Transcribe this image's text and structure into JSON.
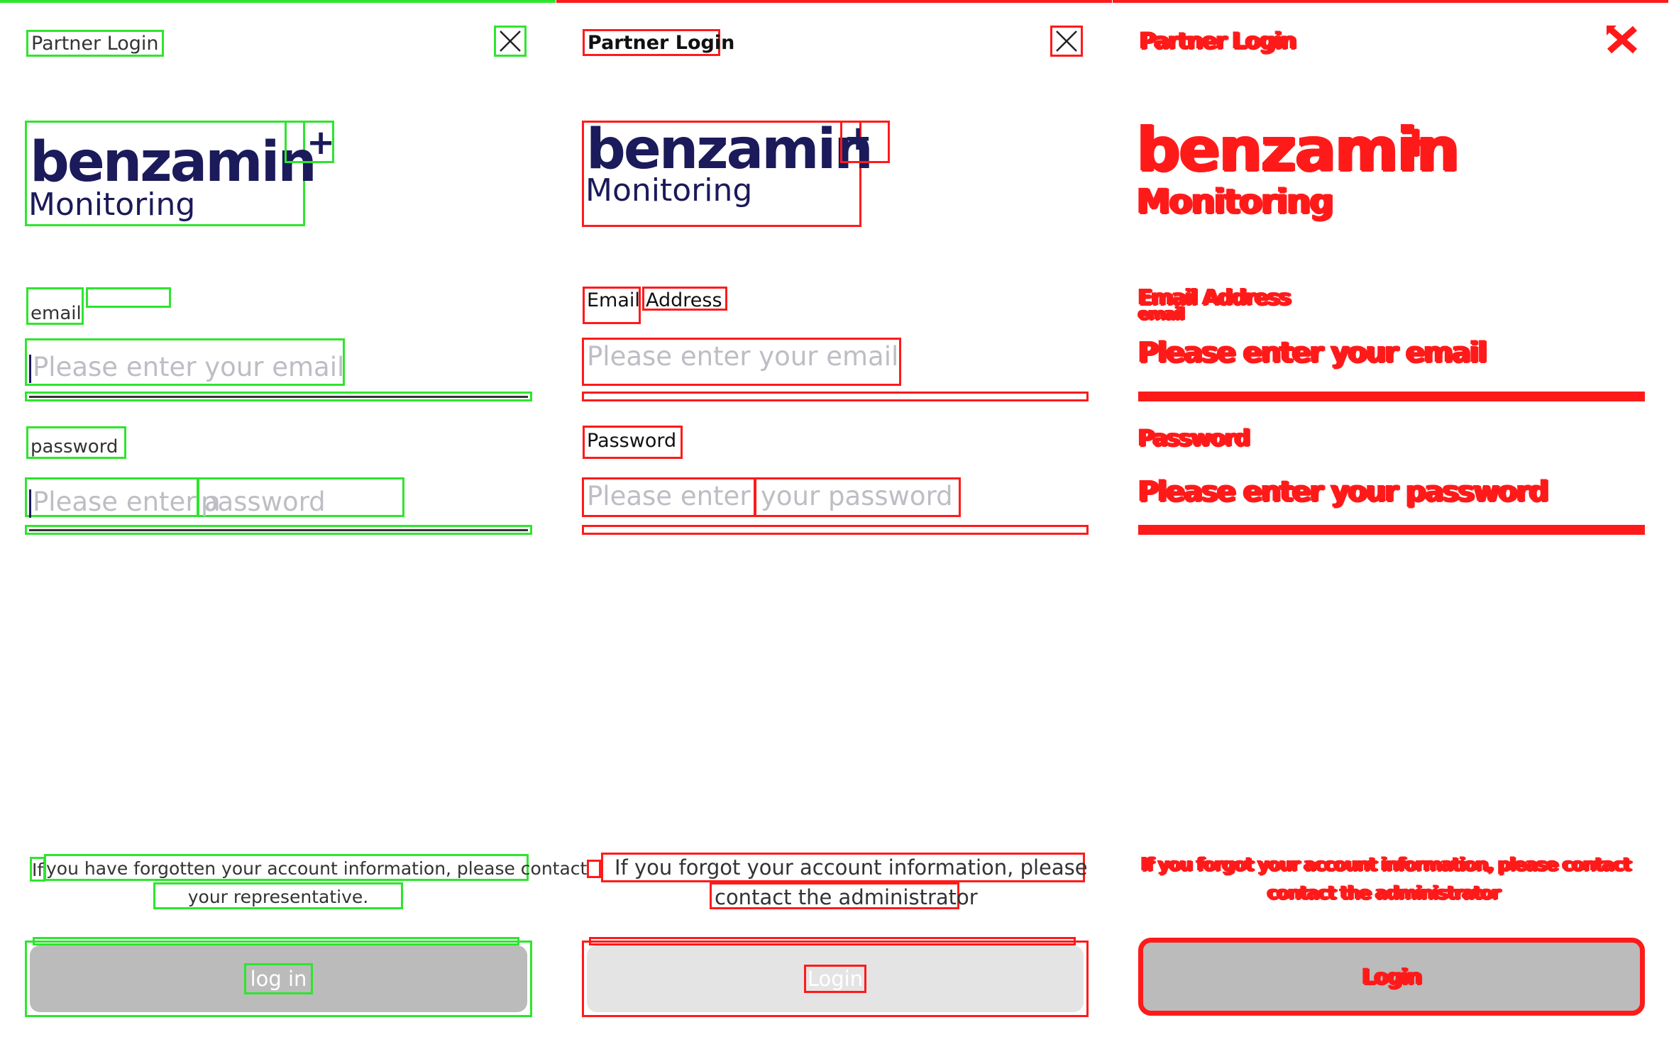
{
  "panels": [
    {
      "title": "Partner Login",
      "brand_name": "benzamin",
      "brand_plus": "+",
      "brand_sub": "Monitoring",
      "email_label": "email",
      "email_placeholder": "Please enter your email",
      "password_label": "password",
      "password_placeholder_1": "Please enter a",
      "password_placeholder_2": "password",
      "note_prefix": "If",
      "note_line1": "you have forgotten your account information, please contact",
      "note_line2": "your representative.",
      "button_label": "log in"
    },
    {
      "title": "Partner Login",
      "brand_name": "benzamin",
      "brand_plus": "+",
      "brand_sub": "Monitoring",
      "email_label_1": "Email",
      "email_label_2": "Address",
      "email_placeholder": "Please enter your email",
      "password_label": "Password",
      "password_placeholder_1": "Please enter",
      "password_placeholder_2": "your password",
      "note_line1": "If you forgot your account information, please",
      "note_line2": "contact the administrator",
      "button_label": "Login"
    },
    {
      "title": "Partner Login",
      "brand_name": "benzamin",
      "brand_plus": "+",
      "brand_sub": "Monitoring",
      "email_label": "Email Address",
      "email_label_sub": "email",
      "email_placeholder": "Please enter your email",
      "password_label": "Password",
      "password_placeholder": "Please enter your password",
      "note_line1": "If you forgot your account information, please contact",
      "note_line2": "contact the administrator",
      "button_label": "Login"
    }
  ],
  "colors": {
    "green_outline": "#2ee52e",
    "red_outline": "#ff1a1a",
    "brand_navy": "#1b1a5a",
    "placeholder": "#bdbdc4",
    "button_gray": "#bbbbbb",
    "button_light": "#e4e4e4"
  }
}
